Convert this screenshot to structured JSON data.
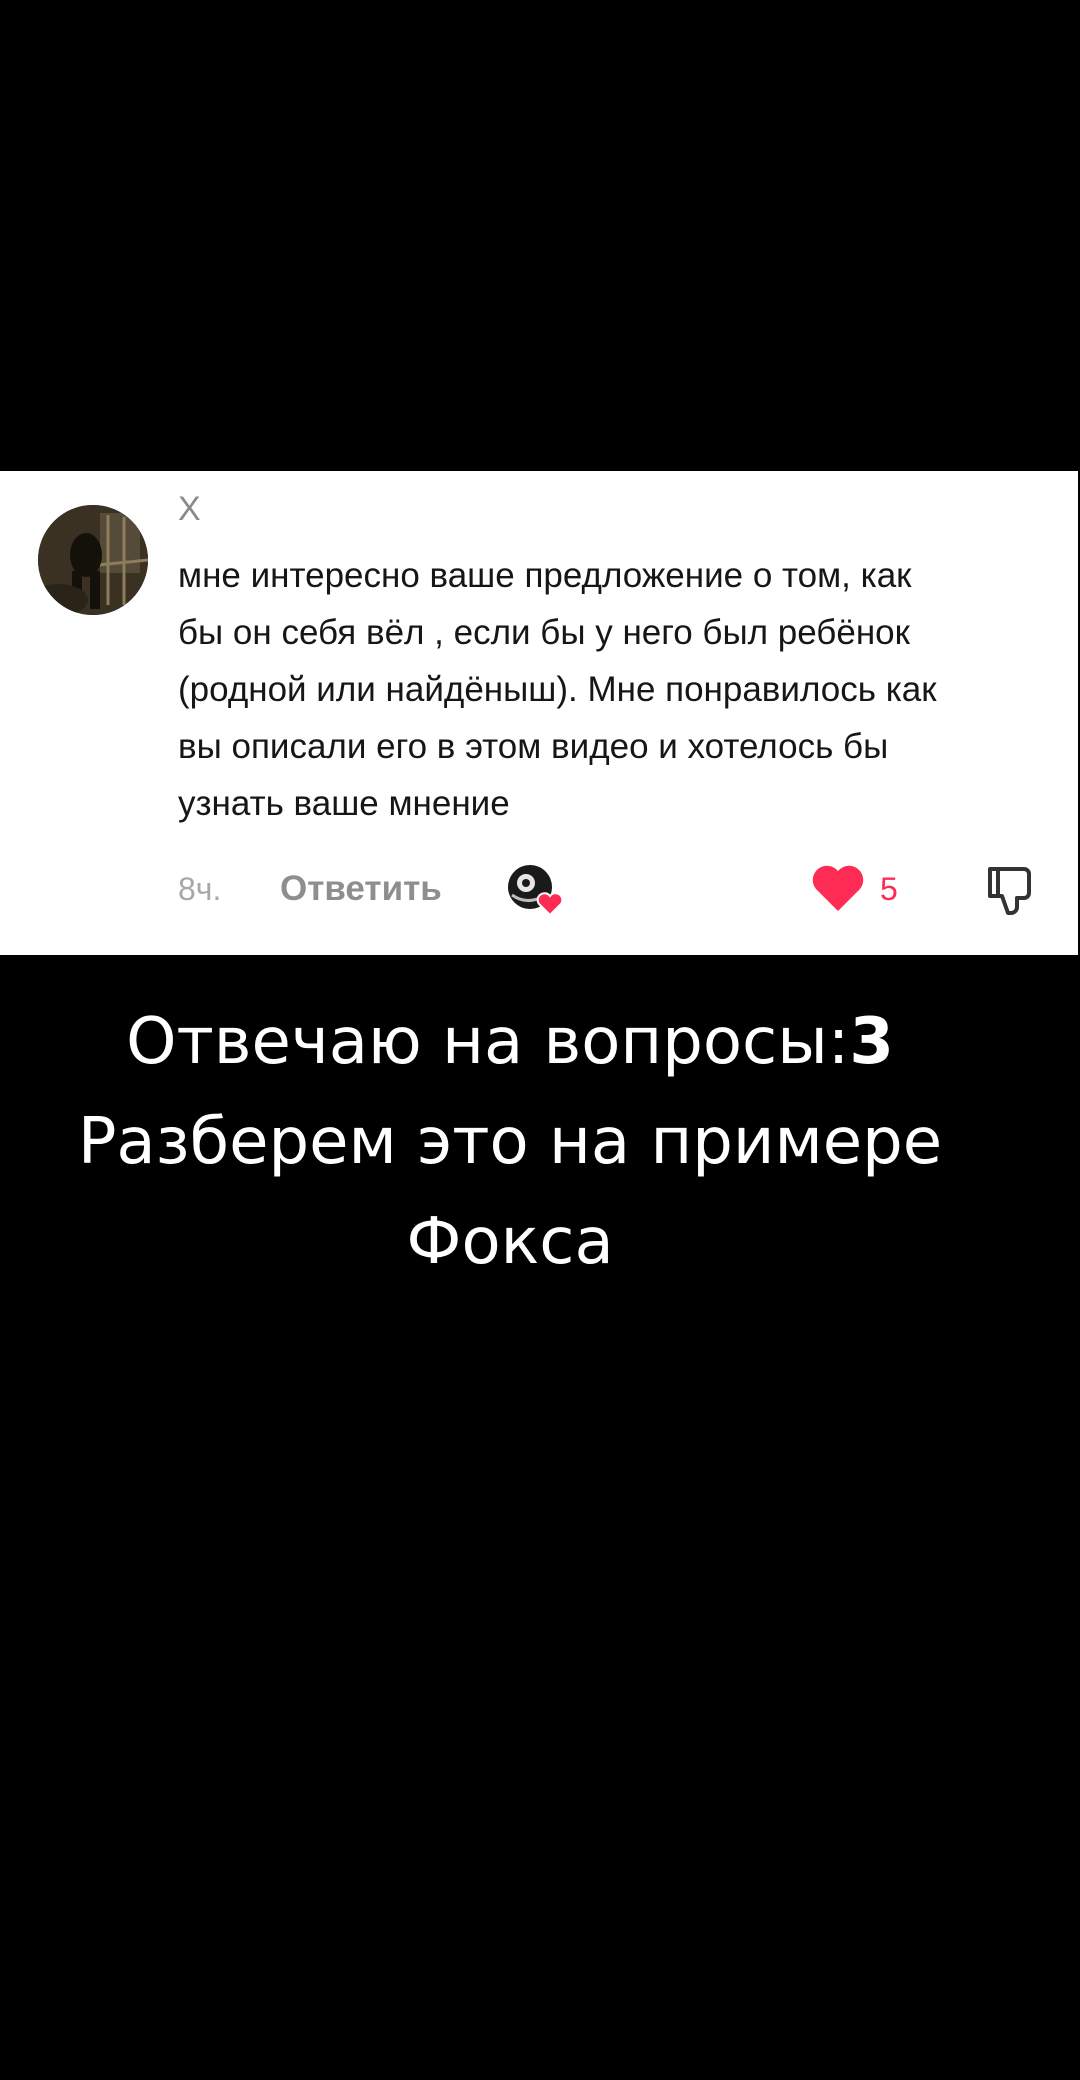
{
  "comment": {
    "username": "Х",
    "text_lines": [
      "мне интересно ваше предложение о том, как",
      "бы он себя вёл , если бы у него был ребёнок",
      "(родной или найдёныш). Мне понравилось как",
      "вы описали его в этом видео и хотелось бы",
      "узнать ваше мнение"
    ],
    "timestamp": "8ч.",
    "reply_label": "Ответить",
    "like_count": "5",
    "icons": {
      "avatar": "user-avatar-photo",
      "creator_like": "creator-liked-badge-icon",
      "like": "heart-icon",
      "dislike": "thumbs-down-icon"
    },
    "colors": {
      "like": "#fe2c55",
      "card_bg": "#ffffff",
      "muted_text": "#8e8e8e"
    }
  },
  "caption": {
    "line1_text": "Отвечаю на вопросы:",
    "line1_number": "3",
    "line2": "Разберем это на примере",
    "line3": "Фокса"
  }
}
